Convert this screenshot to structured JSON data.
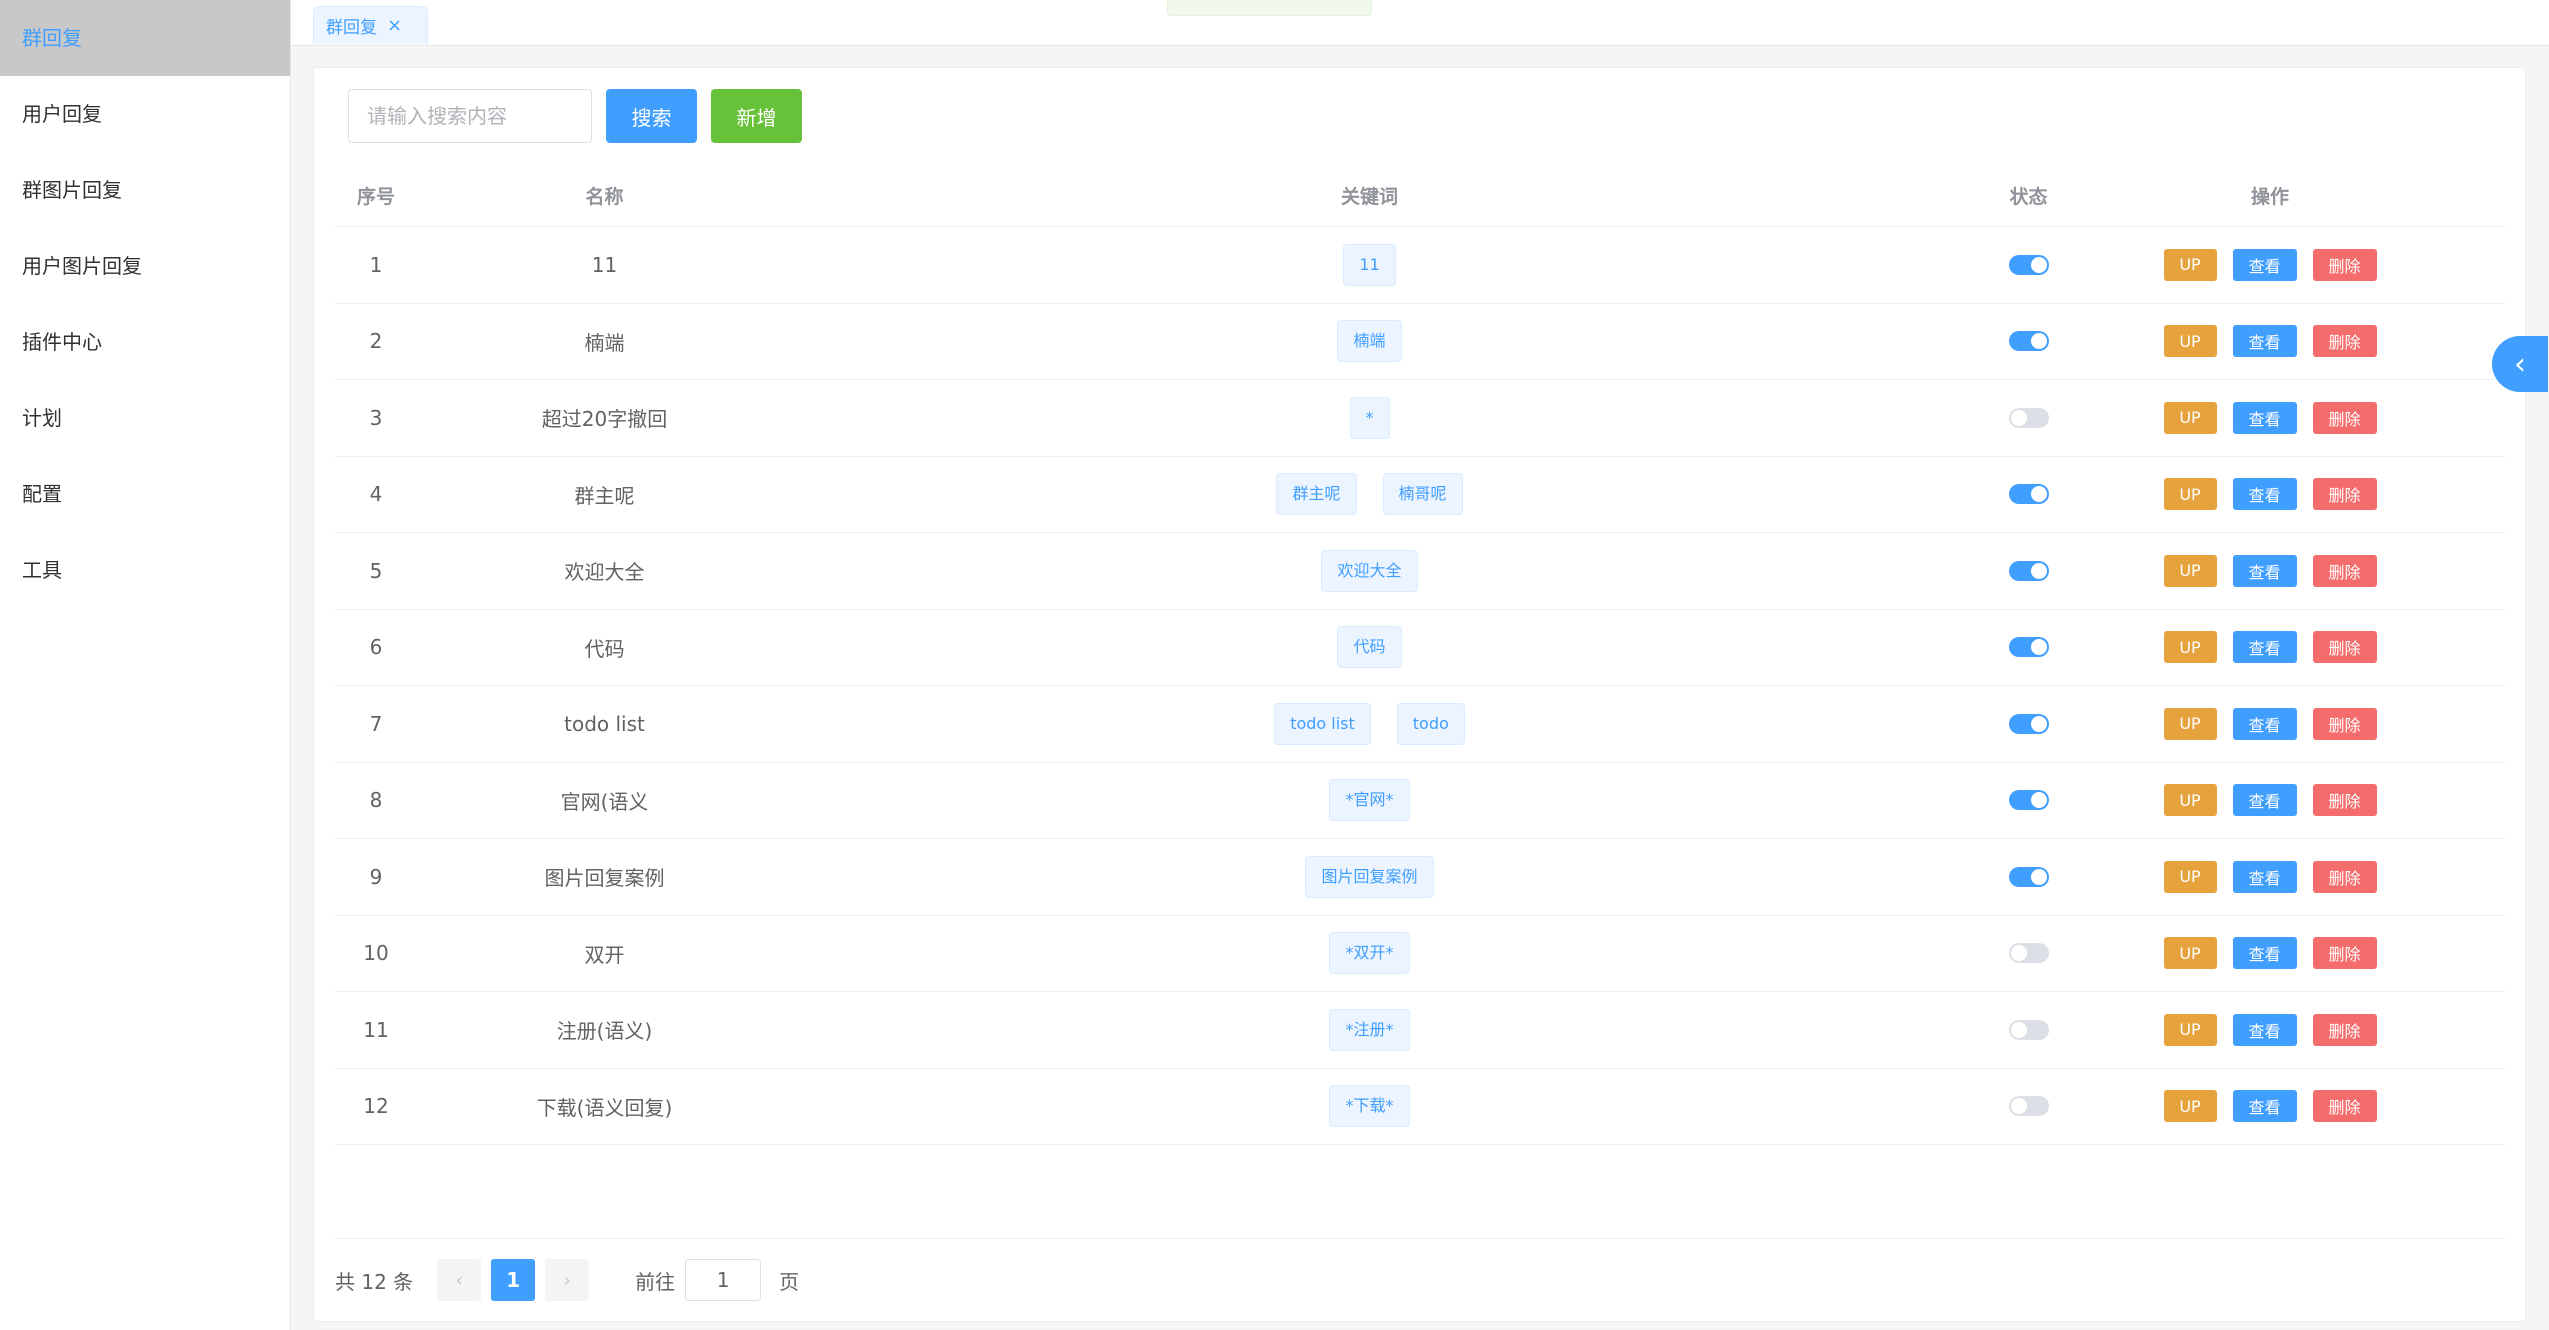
{
  "sidebar": {
    "items": [
      {
        "label": "群回复",
        "active": true
      },
      {
        "label": "用户回复"
      },
      {
        "label": "群图片回复"
      },
      {
        "label": "用户图片回复"
      },
      {
        "label": "插件中心"
      },
      {
        "label": "计划"
      },
      {
        "label": "配置"
      },
      {
        "label": "工具"
      }
    ]
  },
  "tabs": [
    {
      "label": "群回复",
      "close_icon": "close-icon"
    }
  ],
  "toolbar": {
    "search_placeholder": "请输入搜索内容",
    "search_value": "",
    "search_label": "搜索",
    "add_label": "新增"
  },
  "table": {
    "headers": {
      "index": "序号",
      "name": "名称",
      "keywords": "关键词",
      "status": "状态",
      "actions": "操作"
    },
    "actions": {
      "up": "UP",
      "view": "查看",
      "delete": "删除"
    },
    "rows": [
      {
        "index": "1",
        "name": "11",
        "keywords": [
          "11"
        ],
        "enabled": true
      },
      {
        "index": "2",
        "name": "楠端",
        "keywords": [
          "楠端"
        ],
        "enabled": true
      },
      {
        "index": "3",
        "name": "超过20字撤回",
        "keywords": [
          "*"
        ],
        "enabled": false
      },
      {
        "index": "4",
        "name": "群主呢",
        "keywords": [
          "群主呢",
          "楠哥呢"
        ],
        "enabled": true
      },
      {
        "index": "5",
        "name": "欢迎大全",
        "keywords": [
          "欢迎大全"
        ],
        "enabled": true
      },
      {
        "index": "6",
        "name": "代码",
        "keywords": [
          "代码"
        ],
        "enabled": true
      },
      {
        "index": "7",
        "name": "todo list",
        "keywords": [
          "todo list",
          "todo"
        ],
        "enabled": true
      },
      {
        "index": "8",
        "name": "官网(语义",
        "keywords": [
          "*官网*"
        ],
        "enabled": true
      },
      {
        "index": "9",
        "name": "图片回复案例",
        "keywords": [
          "图片回复案例"
        ],
        "enabled": true
      },
      {
        "index": "10",
        "name": "双开",
        "keywords": [
          "*双开*"
        ],
        "enabled": false
      },
      {
        "index": "11",
        "name": "注册(语义)",
        "keywords": [
          "*注册*"
        ],
        "enabled": false
      },
      {
        "index": "12",
        "name": "下载(语义回复)",
        "keywords": [
          "*下载*"
        ],
        "enabled": false
      }
    ]
  },
  "pagination": {
    "total_text": "共 12 条",
    "prev": "‹",
    "current_page": "1",
    "next": "›",
    "goto_label": "前往",
    "goto_value": "1",
    "page_suffix": "页"
  },
  "float_button": {
    "icon": "chevron-left-icon",
    "glyph": "‹"
  },
  "colors": {
    "primary": "#409eff",
    "success": "#67c23a",
    "warning": "#e6a23c",
    "danger": "#f56c6c",
    "sidebar_active_bg": "#c8c8c8"
  }
}
